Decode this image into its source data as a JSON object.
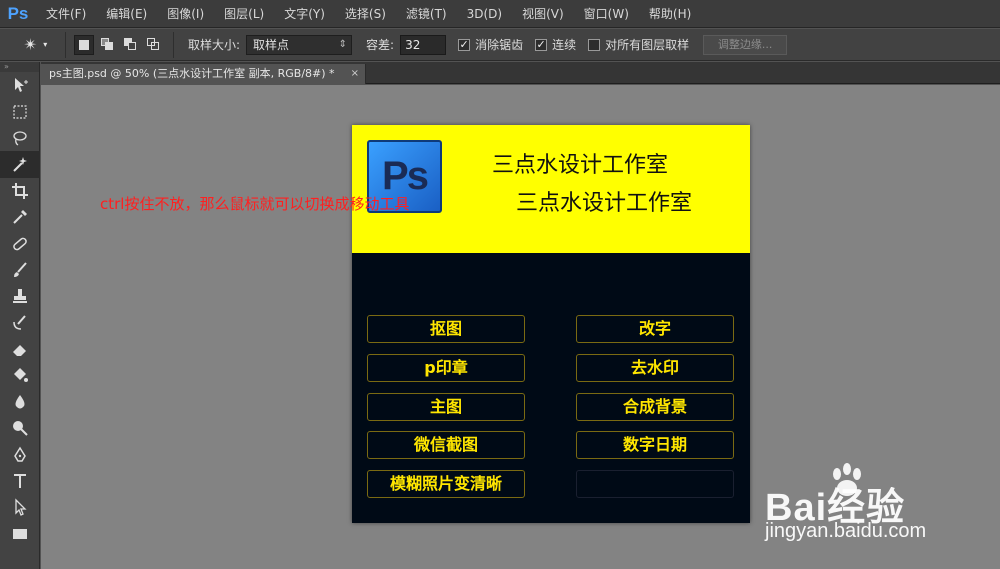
{
  "app": {
    "logo": "Ps",
    "accent": "#4ea3ff"
  },
  "menu": [
    "文件(F)",
    "编辑(E)",
    "图像(I)",
    "图层(L)",
    "文字(Y)",
    "选择(S)",
    "滤镜(T)",
    "3D(D)",
    "视图(V)",
    "窗口(W)",
    "帮助(H)"
  ],
  "options": {
    "tool_icon": "magic-wand-icon",
    "sample_size_label": "取样大小:",
    "sample_size_value": "取样点",
    "tolerance_label": "容差:",
    "tolerance_value": "32",
    "anti_alias": {
      "label": "消除锯齿",
      "checked": true
    },
    "contiguous": {
      "label": "连续",
      "checked": true
    },
    "sample_all_layers": {
      "label": "对所有图层取样",
      "checked": false
    },
    "refine_edge": "调整边缘..."
  },
  "toolbox": {
    "grip": "»",
    "tools": [
      "move-tool-icon",
      "marquee-tool-icon",
      "lasso-tool-icon",
      "magic-wand-tool-icon",
      "crop-tool-icon",
      "eyedropper-tool-icon",
      "healing-brush-tool-icon",
      "brush-tool-icon",
      "stamp-tool-icon",
      "history-brush-tool-icon",
      "eraser-tool-icon",
      "paint-bucket-tool-icon",
      "blur-tool-icon",
      "dodge-tool-icon",
      "pen-tool-icon",
      "type-tool-icon",
      "path-selection-tool-icon",
      "rectangle-tool-icon"
    ],
    "active_index": 3
  },
  "document": {
    "tab_title": "ps主图.psd @ 50% (三点水设计工作室 副本, RGB/8#) *",
    "close": "×",
    "ps_icon_text": "Ps",
    "title_line1": "三点水设计工作室",
    "title_line2": "三点水设计工作室",
    "buttons_left": [
      "抠图",
      "p印章",
      "主图",
      "微信截图",
      "模糊照片变清晰"
    ],
    "buttons_right": [
      "改字",
      "去水印",
      "合成背景",
      "数字日期"
    ],
    "colors": {
      "head": "#ffff00",
      "body": "#000a16",
      "button_text": "#ffe600"
    }
  },
  "annotation": "ctrl按住不放，那么鼠标就可以切换成移动工具",
  "watermark": {
    "brand": "Bai经验",
    "url": "jingyan.baidu.com"
  }
}
